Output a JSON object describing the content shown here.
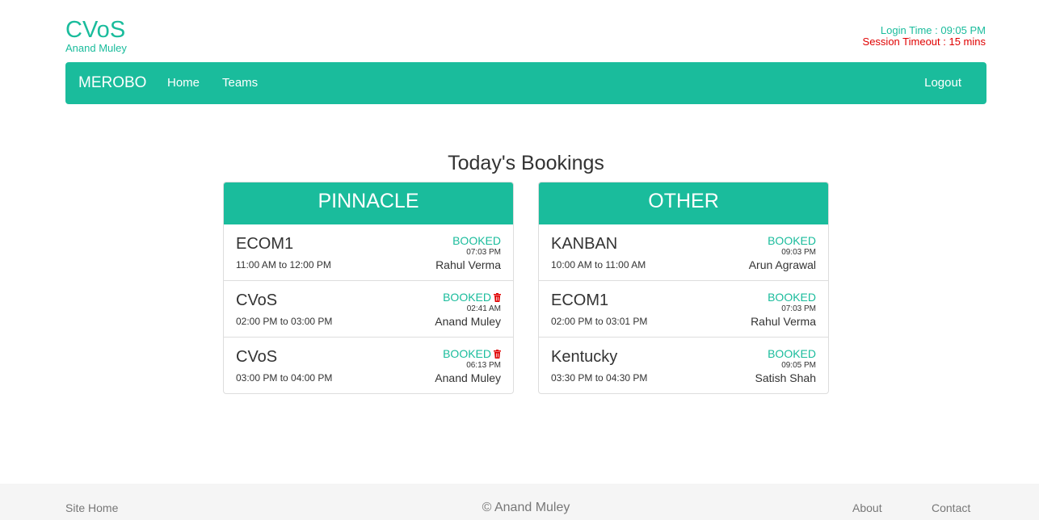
{
  "header": {
    "title": "CVoS",
    "user": "Anand Muley",
    "login_time": "Login Time : 09:05 PM",
    "session_timeout": "Session Timeout : 15 mins"
  },
  "nav": {
    "brand": "MEROBO",
    "home": "Home",
    "teams": "Teams",
    "logout": "Logout"
  },
  "main": {
    "title": "Today's Bookings",
    "panels": [
      {
        "name": "PINNACLE",
        "bookings": [
          {
            "room": "ECOM1",
            "slot": "11:00 AM to 12:00 PM",
            "status": "BOOKED",
            "booked_at": "07:03 PM",
            "booked_by": "Rahul Verma"
          },
          {
            "room": "CVoS",
            "slot": "02:00 PM to 03:00 PM",
            "status": "BOOKED",
            "booked_at": "02:41 AM",
            "booked_by": "Anand Muley"
          },
          {
            "room": "CVoS",
            "slot": "03:00 PM to 04:00 PM",
            "status": "BOOKED",
            "booked_at": "06:13 PM",
            "booked_by": "Anand Muley"
          }
        ]
      },
      {
        "name": "OTHER",
        "bookings": [
          {
            "room": "KANBAN",
            "slot": "10:00 AM to 11:00 AM",
            "status": "BOOKED",
            "booked_at": "09:03 PM",
            "booked_by": "Arun Agrawal"
          },
          {
            "room": "ECOM1",
            "slot": "02:00 PM to 03:01 PM",
            "status": "BOOKED",
            "booked_at": "07:03 PM",
            "booked_by": "Rahul Verma"
          },
          {
            "room": "Kentucky",
            "slot": "03:30 PM to 04:30 PM",
            "status": "BOOKED",
            "booked_at": "09:05 PM",
            "booked_by": "Satish Shah"
          }
        ]
      }
    ]
  },
  "footer": {
    "site_home": "Site Home",
    "copyright": "© Anand Muley",
    "about": "About",
    "contact": "Contact"
  },
  "colors": {
    "accent": "#1abc9c",
    "danger": "#e00000"
  }
}
